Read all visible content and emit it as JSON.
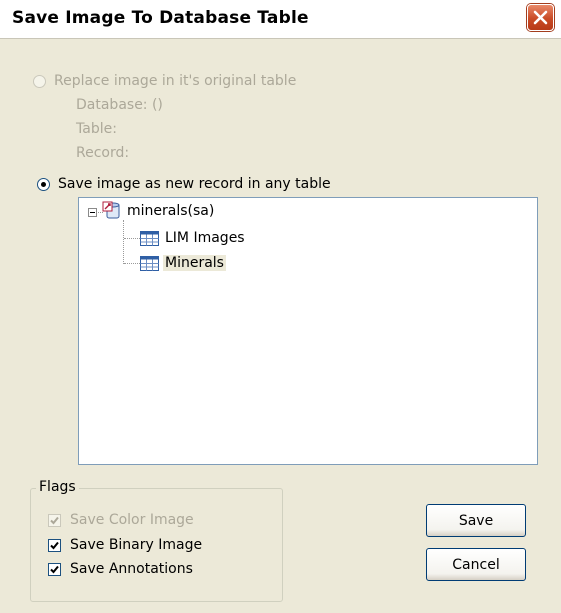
{
  "window": {
    "title": "Save Image To Database Table",
    "close_icon": "close-icon"
  },
  "replace_option": {
    "label": "Replace image in it's original table",
    "selected": false,
    "enabled": false,
    "database_line": "Database:  ()",
    "table_line": "Table:",
    "record_line": "Record:"
  },
  "new_record_option": {
    "label": "Save image as new record in any table",
    "selected": true,
    "enabled": true
  },
  "tree": {
    "root": {
      "label": "minerals(sa)",
      "icon": "database-icon",
      "expanded": true
    },
    "children": [
      {
        "label": "LIM Images",
        "icon": "table-icon",
        "selected": false
      },
      {
        "label": "Minerals",
        "icon": "table-icon",
        "selected": true
      }
    ]
  },
  "flags": {
    "title": "Flags",
    "items": [
      {
        "label": "Save Color Image",
        "checked": true,
        "enabled": false
      },
      {
        "label": "Save Binary Image",
        "checked": true,
        "enabled": true
      },
      {
        "label": "Save Annotations",
        "checked": true,
        "enabled": true
      }
    ]
  },
  "buttons": {
    "save_label": "Save",
    "cancel_label": "Cancel"
  },
  "colors": {
    "dialog_bg": "#ece9d8",
    "disabled_text": "#aca899",
    "tree_border": "#7f9db9",
    "close_button": "#c94b26"
  }
}
